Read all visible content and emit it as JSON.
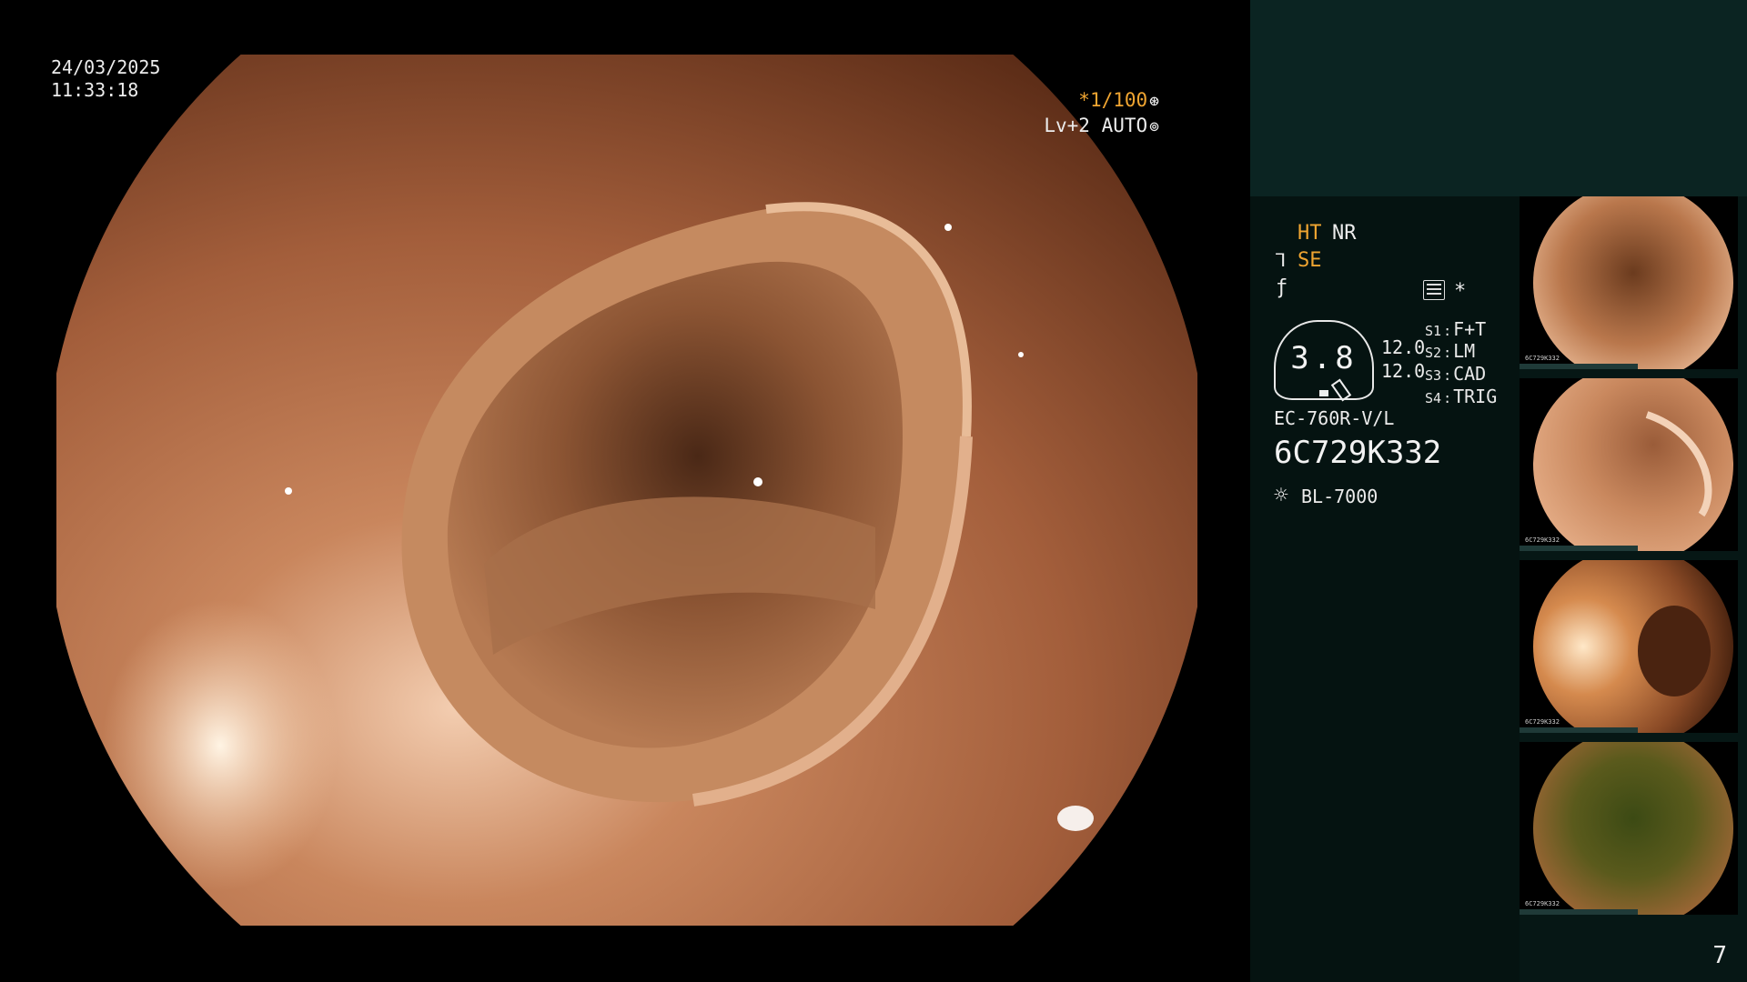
{
  "overlay": {
    "date": "24/03/2025",
    "time": "11:33:18",
    "exposure": "*1/100",
    "exposure_icon": "shutter-icon",
    "level": "Lv+2 AUTO",
    "level_icon": "iris-icon"
  },
  "panel": {
    "ht": "HT",
    "nr": "NR",
    "se": "SE",
    "se_icon": "scope-icon",
    "f_icon": "f-symbol-icon",
    "lcd_icon": "display-icon",
    "star": "*",
    "gauge_value": "3.8",
    "value_1": "12.0",
    "value_2": "12.0",
    "switches": [
      {
        "key": "S1",
        "value": "F+T"
      },
      {
        "key": "S2",
        "value": "LM"
      },
      {
        "key": "S3",
        "value": "CAD"
      },
      {
        "key": "S4",
        "value": "TRIG"
      }
    ],
    "scope_model": "EC-760R-V/L",
    "scope_serial": "6C729K332",
    "light_icon": "lamp-icon",
    "light_source": "BL-7000"
  },
  "thumbnails": [
    {
      "label": "6C729K332"
    },
    {
      "label": "6C729K332"
    },
    {
      "label": "6C729K332"
    },
    {
      "label": "6C729K332"
    }
  ],
  "page_number": "7",
  "colors": {
    "accent": "#f0a531",
    "panel_bg": "#051311",
    "top_band": "#0b2422"
  }
}
